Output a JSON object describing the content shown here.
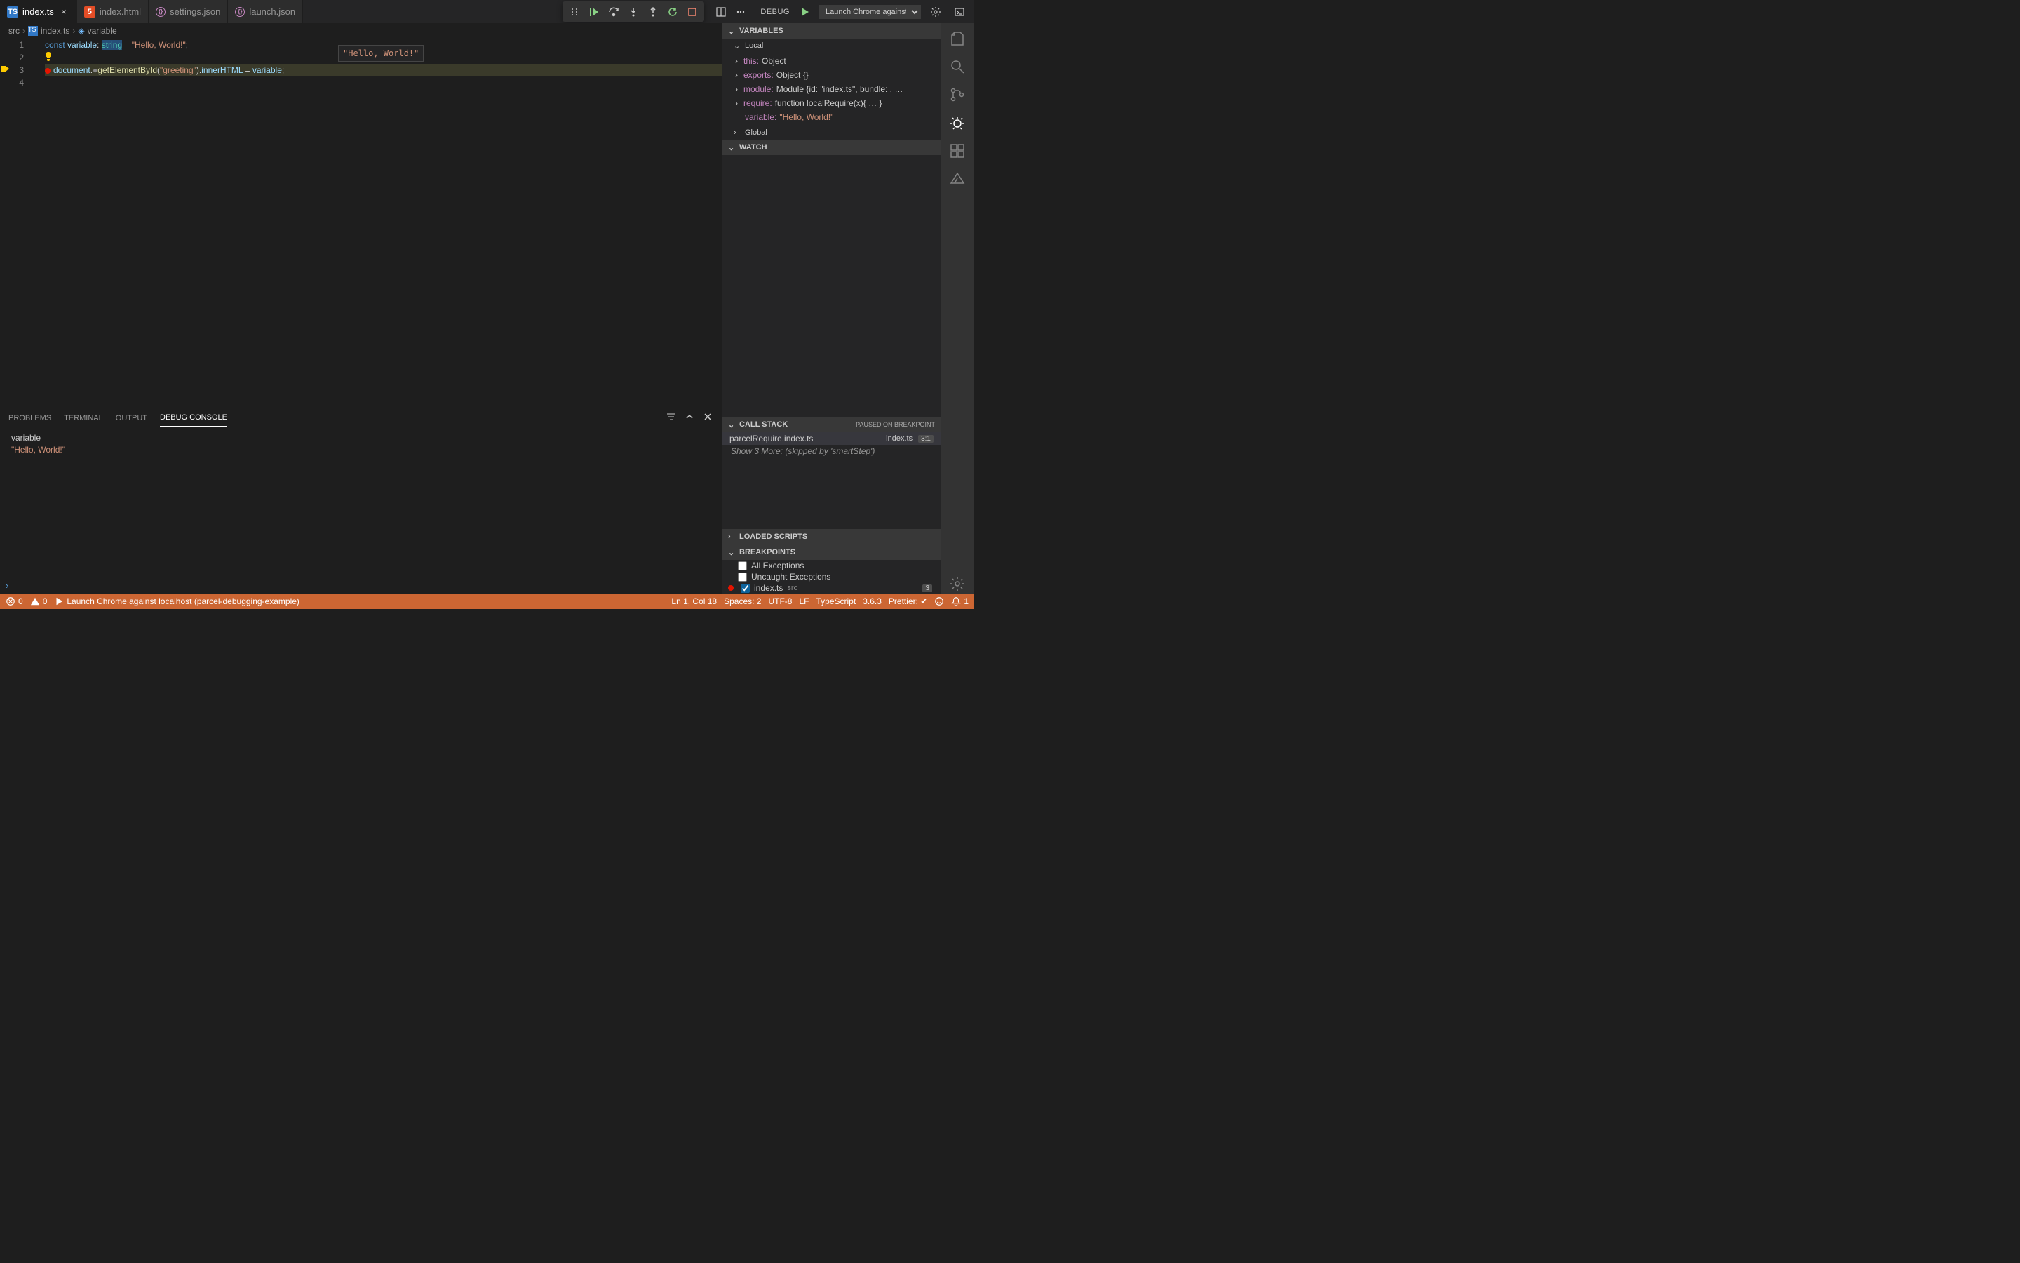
{
  "tabs": [
    {
      "label": "index.ts",
      "icon": "ts",
      "active": true
    },
    {
      "label": "index.html",
      "icon": "html",
      "active": false
    },
    {
      "label": "settings.json",
      "icon": "json",
      "active": false
    },
    {
      "label": "launch.json",
      "icon": "json",
      "active": false
    }
  ],
  "debug": {
    "label": "DEBUG",
    "config": "Launch Chrome against local"
  },
  "breadcrumb": {
    "folder": "src",
    "file": "index.ts",
    "symbol": "variable"
  },
  "editor": {
    "lines": [
      "1",
      "2",
      "3",
      "4"
    ],
    "hover": "\"Hello, World!\"",
    "line1": {
      "const": "const ",
      "var": "variable",
      "colon": ": ",
      "type": "string",
      "eq": " = ",
      "str": "\"Hello, World!\"",
      "semi": ";"
    },
    "line3": {
      "doc": "document",
      "dot1": ".",
      "fn": "getElementById",
      "paren1": "(",
      "arg": "\"greeting\"",
      "paren2": ").",
      "prop": "innerHTML",
      "eq": " = ",
      "var": "variable",
      "semi": ";"
    }
  },
  "panel": {
    "tabs": [
      "PROBLEMS",
      "TERMINAL",
      "OUTPUT",
      "DEBUG CONSOLE"
    ],
    "active": "DEBUG CONSOLE",
    "console": {
      "name": "variable",
      "value": "\"Hello, World!\""
    }
  },
  "variables": {
    "title": "VARIABLES",
    "local": "Local",
    "global": "Global",
    "items": [
      {
        "name": "this:",
        "val": "Object",
        "exp": true
      },
      {
        "name": "exports:",
        "val": "Object {}",
        "exp": true
      },
      {
        "name": "module:",
        "val": "Module {id: \"index.ts\", bundle: , …",
        "exp": true
      },
      {
        "name": "require:",
        "val": "function localRequire(x){ … }",
        "exp": true
      },
      {
        "name": "variable:",
        "val": "\"Hello, World!\"",
        "str": true,
        "exp": false
      }
    ]
  },
  "watch": {
    "title": "WATCH"
  },
  "callstack": {
    "title": "CALL STACK",
    "status": "PAUSED ON BREAKPOINT",
    "frame": {
      "fn": "parcelRequire.index.ts",
      "file": "index.ts",
      "loc": "3:1"
    },
    "skip": "Show 3 More: (skipped by 'smartStep')"
  },
  "loadedScripts": {
    "title": "LOADED SCRIPTS"
  },
  "breakpoints": {
    "title": "BREAKPOINTS",
    "all": "All Exceptions",
    "uncaught": "Uncaught Exceptions",
    "file": {
      "name": "index.ts",
      "path": "src",
      "badge": "3"
    }
  },
  "statusbar": {
    "errors": "0",
    "warnings": "0",
    "launch": "Launch Chrome against localhost (parcel-debugging-example)",
    "pos": "Ln 1, Col 18",
    "spaces": "Spaces: 2",
    "enc": "UTF-8",
    "eol": "LF",
    "lang": "TypeScript",
    "ver": "3.6.3",
    "prettier": "Prettier: ✔",
    "bell": "1"
  }
}
